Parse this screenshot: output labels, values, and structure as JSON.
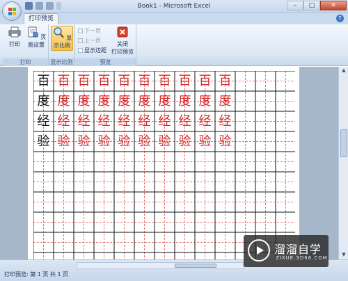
{
  "window": {
    "title": "Book1 - Microsoft Excel"
  },
  "window_controls": {
    "minimize": "–",
    "maximize": "□",
    "close": "✕"
  },
  "tab": {
    "label": "打印预览"
  },
  "help": {
    "label": "?"
  },
  "ribbon": {
    "print_group": {
      "label": "打印",
      "print": "打印",
      "page_setup": "页面设置"
    },
    "zoom_group": {
      "label": "显示比例",
      "zoom": "显示比例"
    },
    "preview_group": {
      "label": "预览",
      "next_page": "下一页",
      "prev_page": "上一页",
      "show_margins": "显示边距",
      "close_preview": "关闭\n打印预览",
      "close_label_1": "关闭",
      "close_label_2": "打印预览"
    }
  },
  "colors": {
    "red_text": "#d42a2a",
    "dash_red": "#e05050",
    "black": "#111111"
  },
  "grid_rows": [
    {
      "lead": "百",
      "repeat": "百"
    },
    {
      "lead": "度",
      "repeat": "度"
    },
    {
      "lead": "经",
      "repeat": "经"
    },
    {
      "lead": "验",
      "repeat": "验"
    }
  ],
  "status": {
    "text": "打印预览: 第 1 页 共 1 页"
  },
  "watermark": {
    "main": "溜溜自学",
    "sub": "ZIXUE.3D66.COM"
  }
}
